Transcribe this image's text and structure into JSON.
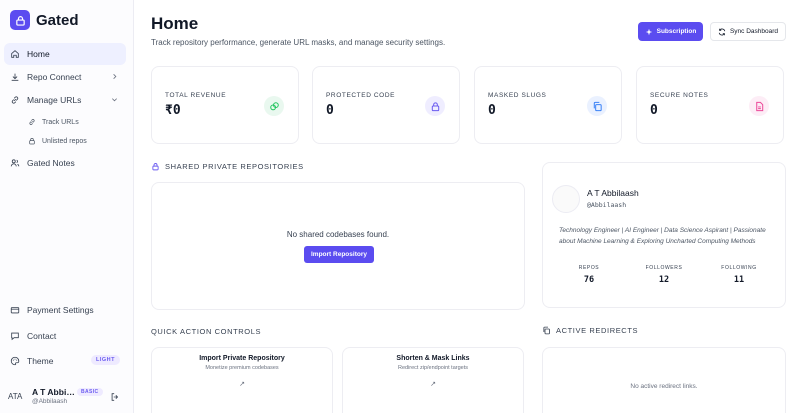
{
  "app": {
    "name": "Gated"
  },
  "sidebar": {
    "items": [
      {
        "label": "Home"
      },
      {
        "label": "Repo Connect"
      },
      {
        "label": "Manage URLs"
      }
    ],
    "sub_items": [
      {
        "label": "Track URLs"
      },
      {
        "label": "Unlisted repos"
      }
    ],
    "gated_notes": "Gated Notes",
    "bottom_items": [
      {
        "label": "Payment Settings"
      },
      {
        "label": "Contact"
      },
      {
        "label": "Theme"
      }
    ],
    "theme_badge": "LIGHT",
    "user": {
      "initials": "ATA",
      "name": "A T Abbilaash",
      "handle": "@Abbilaash",
      "plan": "BASIC"
    }
  },
  "header": {
    "title": "Home",
    "subtitle": "Track repository performance, generate URL masks, and manage security settings.",
    "subscription_label": "Subscription",
    "sync_label": "Sync Dashboard"
  },
  "stats": [
    {
      "label": "TOTAL REVENUE",
      "value": "₹0",
      "icon": "coins-icon",
      "color": "#22c55e",
      "bg": "#e9f8ef"
    },
    {
      "label": "PROTECTED CODE",
      "value": "0",
      "icon": "lock-icon",
      "color": "#6b5bf0",
      "bg": "#efedff"
    },
    {
      "label": "MASKED SLUGS",
      "value": "0",
      "icon": "copy-icon",
      "color": "#3b82f6",
      "bg": "#eaf1ff"
    },
    {
      "label": "SECURE NOTES",
      "value": "0",
      "icon": "file-icon",
      "color": "#ec4899",
      "bg": "#fdedf6"
    }
  ],
  "repos": {
    "heading": "SHARED PRIVATE REPOSITORIES",
    "empty": "No shared codebases found.",
    "import_label": "Import Repository"
  },
  "profile": {
    "name": "A T Abbilaash",
    "handle": "@Abbilaash",
    "bio": "Technology Engineer | AI Engineer | Data Science Aspirant | Passionate about Machine Learning & Exploring Uncharted Computing Methods",
    "stats": [
      {
        "label": "REPOS",
        "value": "76"
      },
      {
        "label": "FOLLOWERS",
        "value": "12"
      },
      {
        "label": "FOLLOWING",
        "value": "11"
      }
    ]
  },
  "quick_actions": {
    "heading": "QUICK ACTION CONTROLS",
    "items": [
      {
        "title": "Import Private Repository",
        "desc": "Monetize premium codebases"
      },
      {
        "title": "Shorten & Mask Links",
        "desc": "Redirect zip/endpoint targets"
      }
    ]
  },
  "redirects": {
    "heading": "ACTIVE REDIRECTS",
    "empty": "No active redirect links."
  }
}
